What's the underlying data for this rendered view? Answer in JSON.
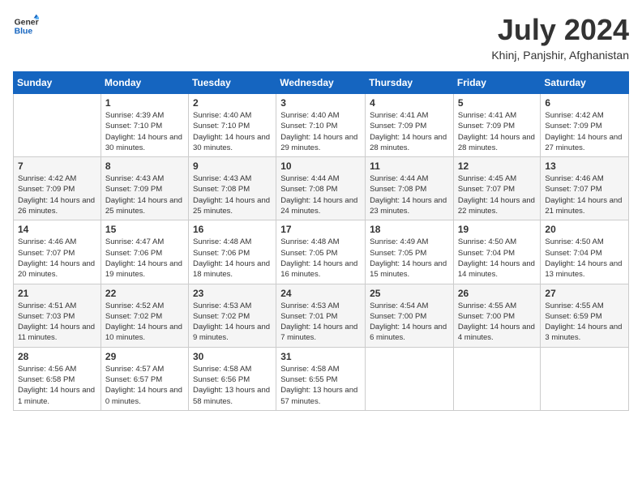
{
  "header": {
    "logo_line1": "General",
    "logo_line2": "Blue",
    "month": "July 2024",
    "location": "Khinj, Panjshir, Afghanistan"
  },
  "days_of_week": [
    "Sunday",
    "Monday",
    "Tuesday",
    "Wednesday",
    "Thursday",
    "Friday",
    "Saturday"
  ],
  "weeks": [
    [
      {
        "day": "",
        "sunrise": "",
        "sunset": "",
        "daylight": ""
      },
      {
        "day": "1",
        "sunrise": "Sunrise: 4:39 AM",
        "sunset": "Sunset: 7:10 PM",
        "daylight": "Daylight: 14 hours and 30 minutes."
      },
      {
        "day": "2",
        "sunrise": "Sunrise: 4:40 AM",
        "sunset": "Sunset: 7:10 PM",
        "daylight": "Daylight: 14 hours and 30 minutes."
      },
      {
        "day": "3",
        "sunrise": "Sunrise: 4:40 AM",
        "sunset": "Sunset: 7:10 PM",
        "daylight": "Daylight: 14 hours and 29 minutes."
      },
      {
        "day": "4",
        "sunrise": "Sunrise: 4:41 AM",
        "sunset": "Sunset: 7:09 PM",
        "daylight": "Daylight: 14 hours and 28 minutes."
      },
      {
        "day": "5",
        "sunrise": "Sunrise: 4:41 AM",
        "sunset": "Sunset: 7:09 PM",
        "daylight": "Daylight: 14 hours and 28 minutes."
      },
      {
        "day": "6",
        "sunrise": "Sunrise: 4:42 AM",
        "sunset": "Sunset: 7:09 PM",
        "daylight": "Daylight: 14 hours and 27 minutes."
      }
    ],
    [
      {
        "day": "7",
        "sunrise": "Sunrise: 4:42 AM",
        "sunset": "Sunset: 7:09 PM",
        "daylight": "Daylight: 14 hours and 26 minutes."
      },
      {
        "day": "8",
        "sunrise": "Sunrise: 4:43 AM",
        "sunset": "Sunset: 7:09 PM",
        "daylight": "Daylight: 14 hours and 25 minutes."
      },
      {
        "day": "9",
        "sunrise": "Sunrise: 4:43 AM",
        "sunset": "Sunset: 7:08 PM",
        "daylight": "Daylight: 14 hours and 25 minutes."
      },
      {
        "day": "10",
        "sunrise": "Sunrise: 4:44 AM",
        "sunset": "Sunset: 7:08 PM",
        "daylight": "Daylight: 14 hours and 24 minutes."
      },
      {
        "day": "11",
        "sunrise": "Sunrise: 4:44 AM",
        "sunset": "Sunset: 7:08 PM",
        "daylight": "Daylight: 14 hours and 23 minutes."
      },
      {
        "day": "12",
        "sunrise": "Sunrise: 4:45 AM",
        "sunset": "Sunset: 7:07 PM",
        "daylight": "Daylight: 14 hours and 22 minutes."
      },
      {
        "day": "13",
        "sunrise": "Sunrise: 4:46 AM",
        "sunset": "Sunset: 7:07 PM",
        "daylight": "Daylight: 14 hours and 21 minutes."
      }
    ],
    [
      {
        "day": "14",
        "sunrise": "Sunrise: 4:46 AM",
        "sunset": "Sunset: 7:07 PM",
        "daylight": "Daylight: 14 hours and 20 minutes."
      },
      {
        "day": "15",
        "sunrise": "Sunrise: 4:47 AM",
        "sunset": "Sunset: 7:06 PM",
        "daylight": "Daylight: 14 hours and 19 minutes."
      },
      {
        "day": "16",
        "sunrise": "Sunrise: 4:48 AM",
        "sunset": "Sunset: 7:06 PM",
        "daylight": "Daylight: 14 hours and 18 minutes."
      },
      {
        "day": "17",
        "sunrise": "Sunrise: 4:48 AM",
        "sunset": "Sunset: 7:05 PM",
        "daylight": "Daylight: 14 hours and 16 minutes."
      },
      {
        "day": "18",
        "sunrise": "Sunrise: 4:49 AM",
        "sunset": "Sunset: 7:05 PM",
        "daylight": "Daylight: 14 hours and 15 minutes."
      },
      {
        "day": "19",
        "sunrise": "Sunrise: 4:50 AM",
        "sunset": "Sunset: 7:04 PM",
        "daylight": "Daylight: 14 hours and 14 minutes."
      },
      {
        "day": "20",
        "sunrise": "Sunrise: 4:50 AM",
        "sunset": "Sunset: 7:04 PM",
        "daylight": "Daylight: 14 hours and 13 minutes."
      }
    ],
    [
      {
        "day": "21",
        "sunrise": "Sunrise: 4:51 AM",
        "sunset": "Sunset: 7:03 PM",
        "daylight": "Daylight: 14 hours and 11 minutes."
      },
      {
        "day": "22",
        "sunrise": "Sunrise: 4:52 AM",
        "sunset": "Sunset: 7:02 PM",
        "daylight": "Daylight: 14 hours and 10 minutes."
      },
      {
        "day": "23",
        "sunrise": "Sunrise: 4:53 AM",
        "sunset": "Sunset: 7:02 PM",
        "daylight": "Daylight: 14 hours and 9 minutes."
      },
      {
        "day": "24",
        "sunrise": "Sunrise: 4:53 AM",
        "sunset": "Sunset: 7:01 PM",
        "daylight": "Daylight: 14 hours and 7 minutes."
      },
      {
        "day": "25",
        "sunrise": "Sunrise: 4:54 AM",
        "sunset": "Sunset: 7:00 PM",
        "daylight": "Daylight: 14 hours and 6 minutes."
      },
      {
        "day": "26",
        "sunrise": "Sunrise: 4:55 AM",
        "sunset": "Sunset: 7:00 PM",
        "daylight": "Daylight: 14 hours and 4 minutes."
      },
      {
        "day": "27",
        "sunrise": "Sunrise: 4:55 AM",
        "sunset": "Sunset: 6:59 PM",
        "daylight": "Daylight: 14 hours and 3 minutes."
      }
    ],
    [
      {
        "day": "28",
        "sunrise": "Sunrise: 4:56 AM",
        "sunset": "Sunset: 6:58 PM",
        "daylight": "Daylight: 14 hours and 1 minute."
      },
      {
        "day": "29",
        "sunrise": "Sunrise: 4:57 AM",
        "sunset": "Sunset: 6:57 PM",
        "daylight": "Daylight: 14 hours and 0 minutes."
      },
      {
        "day": "30",
        "sunrise": "Sunrise: 4:58 AM",
        "sunset": "Sunset: 6:56 PM",
        "daylight": "Daylight: 13 hours and 58 minutes."
      },
      {
        "day": "31",
        "sunrise": "Sunrise: 4:58 AM",
        "sunset": "Sunset: 6:55 PM",
        "daylight": "Daylight: 13 hours and 57 minutes."
      },
      {
        "day": "",
        "sunrise": "",
        "sunset": "",
        "daylight": ""
      },
      {
        "day": "",
        "sunrise": "",
        "sunset": "",
        "daylight": ""
      },
      {
        "day": "",
        "sunrise": "",
        "sunset": "",
        "daylight": ""
      }
    ]
  ]
}
